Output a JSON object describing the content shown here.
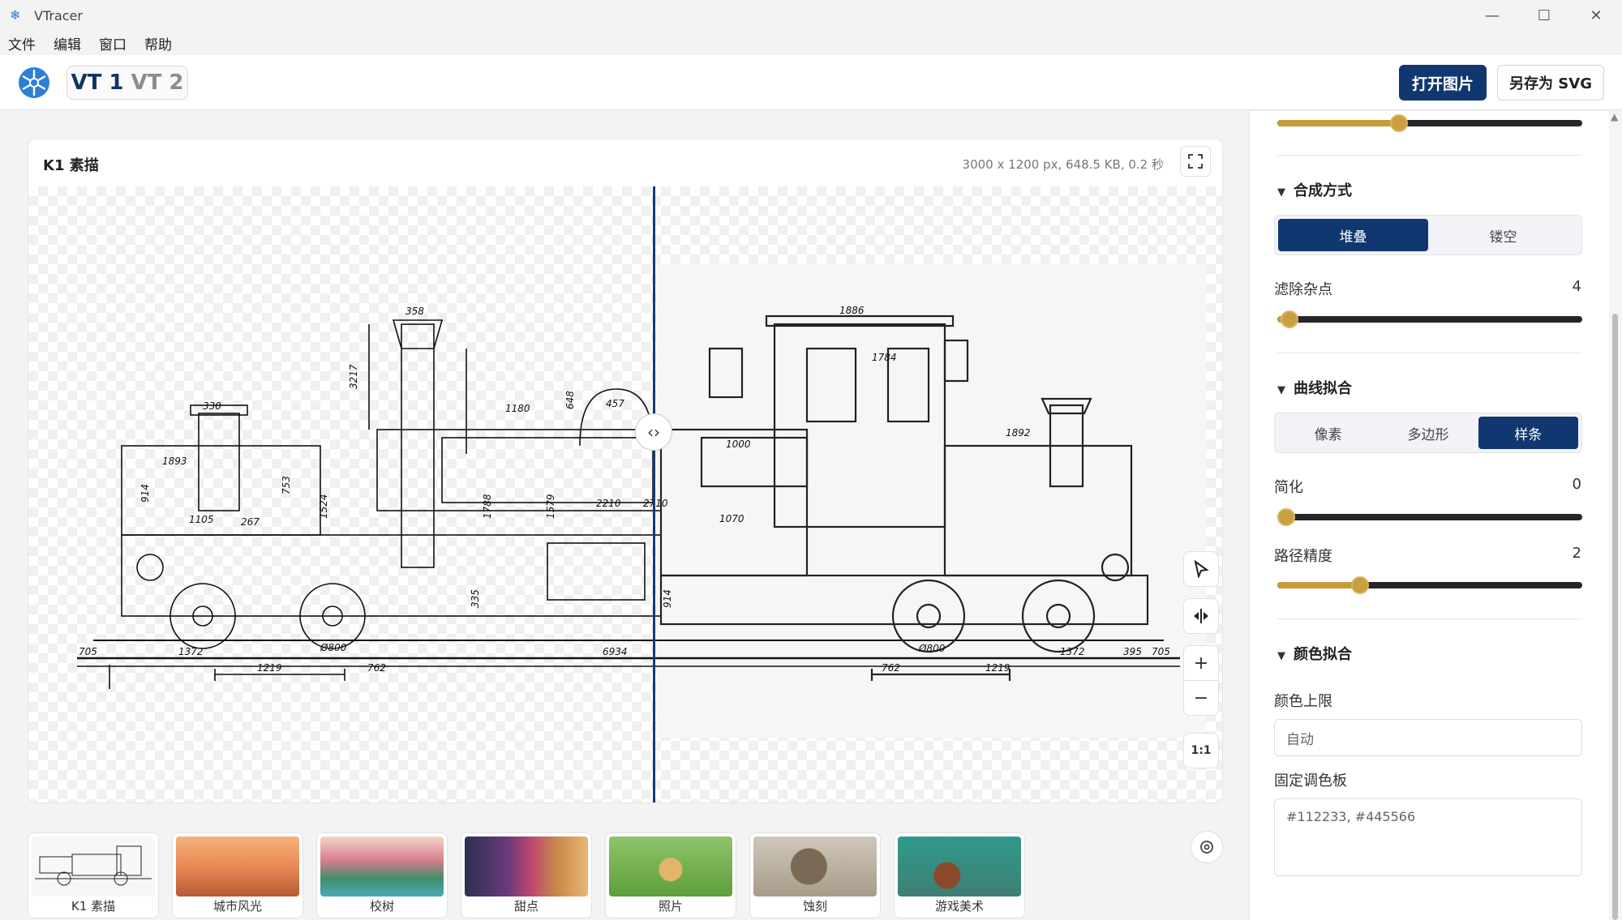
{
  "window": {
    "title": "VTracer",
    "app_icon": "snowflake-icon"
  },
  "menu": [
    "文件",
    "编辑",
    "窗口",
    "帮助"
  ],
  "toolbar": {
    "vt1": "VT 1",
    "vt2": "VT 2",
    "open_label": "打开图片",
    "save_label": "另存为 SVG"
  },
  "preview": {
    "title": "K1 素描",
    "meta": "3000 x 1200 px, 648.5 KB, 0.2 秒",
    "zoom_reset": "1:1",
    "drawing_dims": [
      "358",
      "3217",
      "330",
      "1893",
      "914",
      "753",
      "1105",
      "267",
      "1524",
      "1180",
      "1788",
      "1579",
      "2210",
      "2710",
      "648",
      "457",
      "705",
      "1372",
      "1219",
      "762",
      "Ø800",
      "6934",
      "1886",
      "1784",
      "1000",
      "1070",
      "1892",
      "762",
      "1219",
      "1372",
      "705",
      "Ø800",
      "395",
      "914",
      "335"
    ]
  },
  "samples": [
    {
      "label": "K1 素描"
    },
    {
      "label": "城市风光"
    },
    {
      "label": "校树"
    },
    {
      "label": "甜点"
    },
    {
      "label": "照片"
    },
    {
      "label": "蚀刻"
    },
    {
      "label": "游戏美术"
    }
  ],
  "panel": {
    "top_slider": {
      "value_fraction": 0.4
    },
    "composite": {
      "title": "合成方式",
      "options": [
        "堆叠",
        "镂空"
      ],
      "selected": 0
    },
    "filter_speckle": {
      "label": "滤除杂点",
      "value": "4",
      "fraction": 0.04
    },
    "curve": {
      "title": "曲线拟合",
      "options": [
        "像素",
        "多边形",
        "样条"
      ],
      "selected": 2
    },
    "simplify": {
      "label": "简化",
      "value": "0",
      "fraction": 0.0
    },
    "path_precision": {
      "label": "路径精度",
      "value": "2",
      "fraction": 0.27
    },
    "color": {
      "title": "颜色拟合",
      "max_label": "颜色上限",
      "max_placeholder": "自动",
      "palette_label": "固定调色板",
      "palette_placeholder": "#112233, #445566"
    }
  },
  "colors": {
    "accent": "#113770",
    "slider_fill": "#c79a3a",
    "divider": "#143b73"
  }
}
